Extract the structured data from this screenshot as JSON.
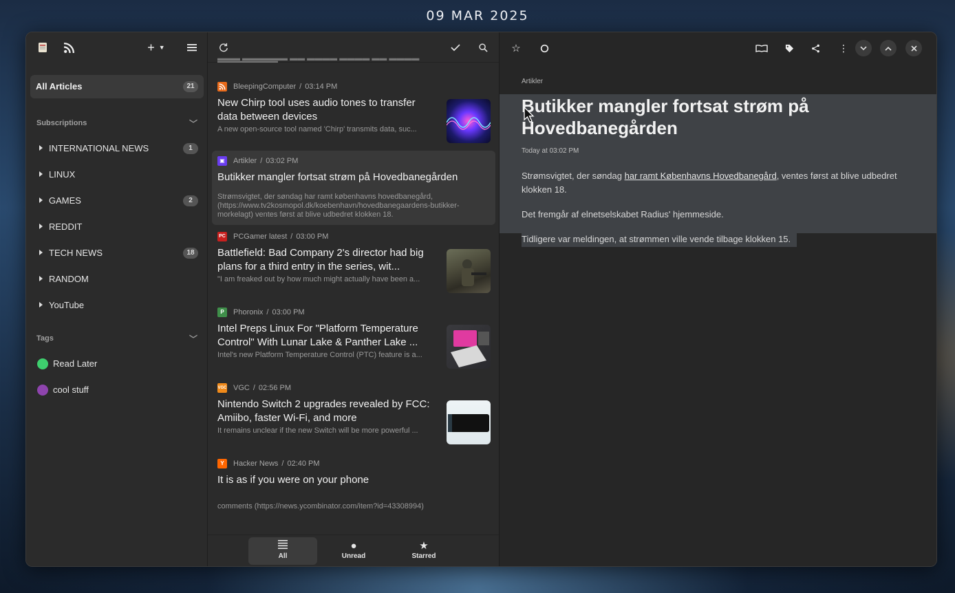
{
  "desktop": {
    "date": "09 MAR 2025"
  },
  "sidebar": {
    "all_articles": {
      "label": "All Articles",
      "count": "21"
    },
    "subscriptions_heading": "Subscriptions",
    "feeds": [
      {
        "label": "INTERNATIONAL NEWS",
        "count": "1"
      },
      {
        "label": "LINUX",
        "count": ""
      },
      {
        "label": "GAMES",
        "count": "2"
      },
      {
        "label": "REDDIT",
        "count": ""
      },
      {
        "label": "TECH NEWS",
        "count": "18"
      },
      {
        "label": "RANDOM",
        "count": ""
      },
      {
        "label": "YouTube",
        "count": ""
      }
    ],
    "tags_heading": "Tags",
    "tags": [
      {
        "label": "Read Later",
        "color": "#3ecf6e"
      },
      {
        "label": "cool stuff",
        "color": "#8e44ad"
      }
    ]
  },
  "list": {
    "articles": [
      {
        "source": "BleepingComputer",
        "time": "03:14 PM",
        "title": "New Chirp tool uses audio tones to transfer data between devices",
        "summary": "A new open-source tool named 'Chirp' transmits data, suc...",
        "favicon_color": "#e86a1a"
      },
      {
        "source": "Artikler",
        "time": "03:02 PM",
        "title": "Butikker mangler fortsat strøm på Hovedbanegården",
        "summary": "Strømsvigtet, der søndag har ramt københavns hovedbanegård, (https://www.tv2kosmopol.dk/koebenhavn/hovedbanegaardens-butikker-morkelagt) ventes først at blive udbedret klokken 18.",
        "favicon_color": "#6a3df0"
      },
      {
        "source": "PCGamer latest",
        "time": "03:00 PM",
        "title": "Battlefield: Bad Company 2's director had big plans for a third entry in the series, wit...",
        "summary": "\"I am freaked out by how much might actually have been a...",
        "favicon_color": "#c8201e"
      },
      {
        "source": "Phoronix",
        "time": "03:00 PM",
        "title": "Intel Preps Linux For \"Platform Temperature Control\" With Lunar Lake & Panther Lake ...",
        "summary": "Intel's new Platform Temperature Control (PTC) feature is a...",
        "favicon_color": "#3f8f4a"
      },
      {
        "source": "VGC",
        "time": "02:56 PM",
        "title": "Nintendo Switch 2 upgrades revealed by FCC: Amiibo, faster Wi-Fi, and more",
        "summary": "It remains unclear if the new Switch will be more powerful ...",
        "favicon_color": "#f08a1a"
      },
      {
        "source": "Hacker News",
        "time": "02:40 PM",
        "title": "It is as if you were on your phone",
        "summary": "comments (https://news.ycombinator.com/item?id=43308994)",
        "favicon_color": "#ff6600"
      }
    ],
    "tabs": {
      "all": "All",
      "unread": "Unread",
      "starred": "Starred"
    }
  },
  "reader": {
    "feed": "Artikler",
    "title": "Butikker mangler fortsat strøm på Hovedbanegården",
    "date": "Today at 03:02 PM",
    "p1_before": "Strømsvigtet, der søndag ",
    "p1_link": "har ramt Københavns Hovedbanegård",
    "p1_after": ", ventes først at blive udbedret klokken 18.",
    "p2": "Det fremgår af elnetselskabet Radius' hjemmeside.",
    "p3": "Tidligere var meldingen, at strømmen ville vende tilbage klokken 15."
  }
}
